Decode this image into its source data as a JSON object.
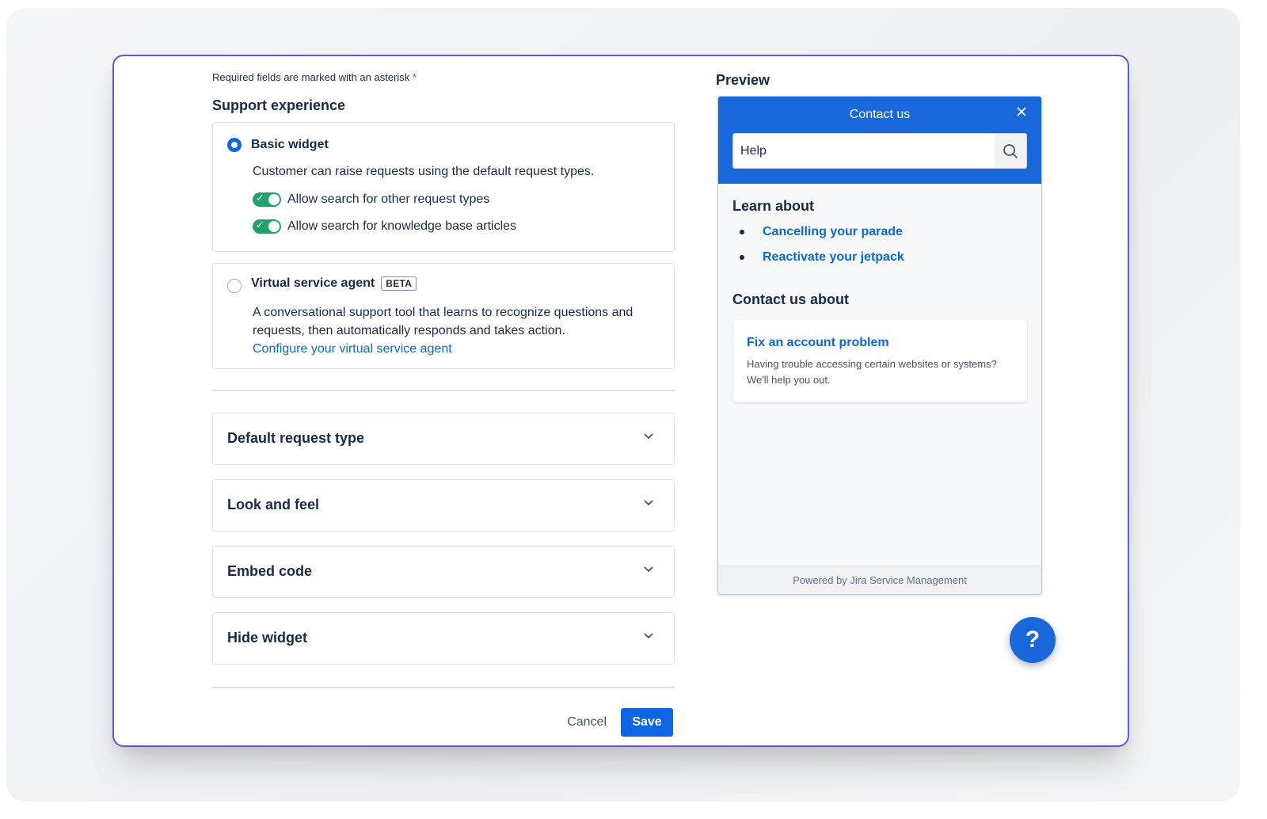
{
  "form": {
    "required_note": "Required fields are marked with an asterisk",
    "required_asterisk": "*",
    "section_title": "Support experience",
    "basic_widget": {
      "title": "Basic widget",
      "selected": true,
      "description": "Customer can raise requests using the default request types.",
      "toggles": [
        {
          "label": "Allow search for other request types",
          "on": true
        },
        {
          "label": "Allow search for knowledge base articles",
          "on": true
        }
      ]
    },
    "virtual_agent": {
      "title": "Virtual service agent",
      "badge": "BETA",
      "selected": false,
      "description": "A conversational support tool that learns to recognize questions and requests, then automatically responds and takes action.",
      "link": "Configure your virtual service agent"
    },
    "accordions": [
      {
        "label": "Default request type"
      },
      {
        "label": "Look and feel"
      },
      {
        "label": "Embed code"
      },
      {
        "label": "Hide widget"
      }
    ],
    "cancel_label": "Cancel",
    "save_label": "Save"
  },
  "preview": {
    "title": "Preview",
    "widget": {
      "header_title": "Contact us",
      "search_value": "Help",
      "learn_title": "Learn about",
      "learn_items": [
        "Cancelling your parade",
        "Reactivate your jetpack"
      ],
      "contact_title": "Contact us about",
      "request": {
        "title": "Fix an account problem",
        "description": "Having trouble accessing certain websites or systems? We'll help you out."
      },
      "footer": "Powered by Jira Service Management"
    },
    "help_button": "?"
  },
  "colors": {
    "accent": "#0c66e4",
    "widget_header": "#1868db",
    "frame_border": "#6554e8",
    "toggle_on": "#22a06b"
  },
  "icons": [
    "close-icon",
    "search-icon",
    "chevron-down-icon",
    "check-icon",
    "help-icon"
  ]
}
